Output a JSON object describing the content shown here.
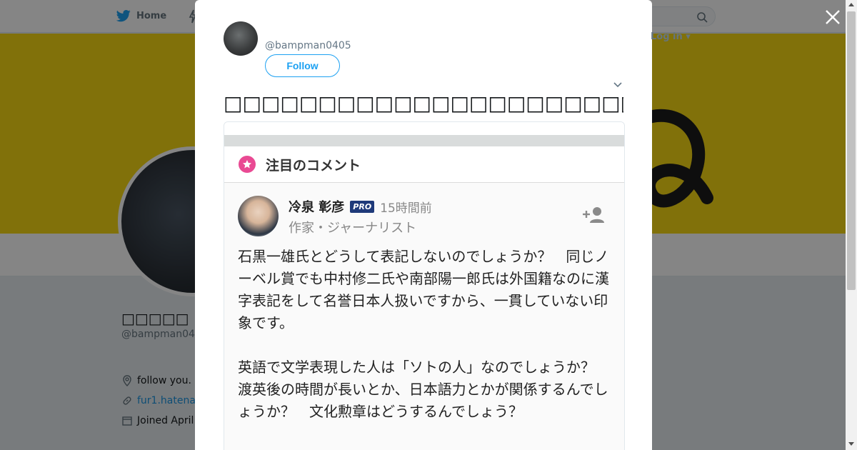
{
  "background": {
    "nav": {
      "home_label": "Home",
      "login_label": "Log in"
    },
    "profile": {
      "name": "□□□□□",
      "handle": "@bampman04",
      "bio": "follow you.",
      "link": "fur1.hatena",
      "joined": "Joined April"
    },
    "colors": {
      "banner": "#f7d914",
      "accent": "#1da1f2"
    }
  },
  "modal": {
    "user": {
      "handle": "@bampman0405"
    },
    "follow_label": "Follow",
    "tweet_text": "□□□□□□□□□□□□□□□□□□□□□□□□□□□□□□□□",
    "media": {
      "section_title": "注目のコメント",
      "commenter": {
        "name": "冷泉 彰彦",
        "badge": "PRO",
        "time": "15時間前",
        "role": "作家・ジャーナリスト"
      },
      "comment_paragraphs": [
        "石黒一雄氏とどうして表記しないのでしょうか？　同じノーベル賞でも中村修二氏や南部陽一郎氏は外国籍なのに漢字表記をして名誉日本人扱いですから、一貫していない印象です。",
        "英語で文学表現した人は「ソトの人」なのでしょうか？　渡英後の時間が長いとか、日本語力とかが関係するんでしょうか？　文化勲章はどうするんでしょう？"
      ]
    }
  },
  "icons": {
    "close": "close-icon",
    "caret": "chevron-down-icon",
    "star": "star-icon",
    "add_user": "add-user-icon"
  }
}
